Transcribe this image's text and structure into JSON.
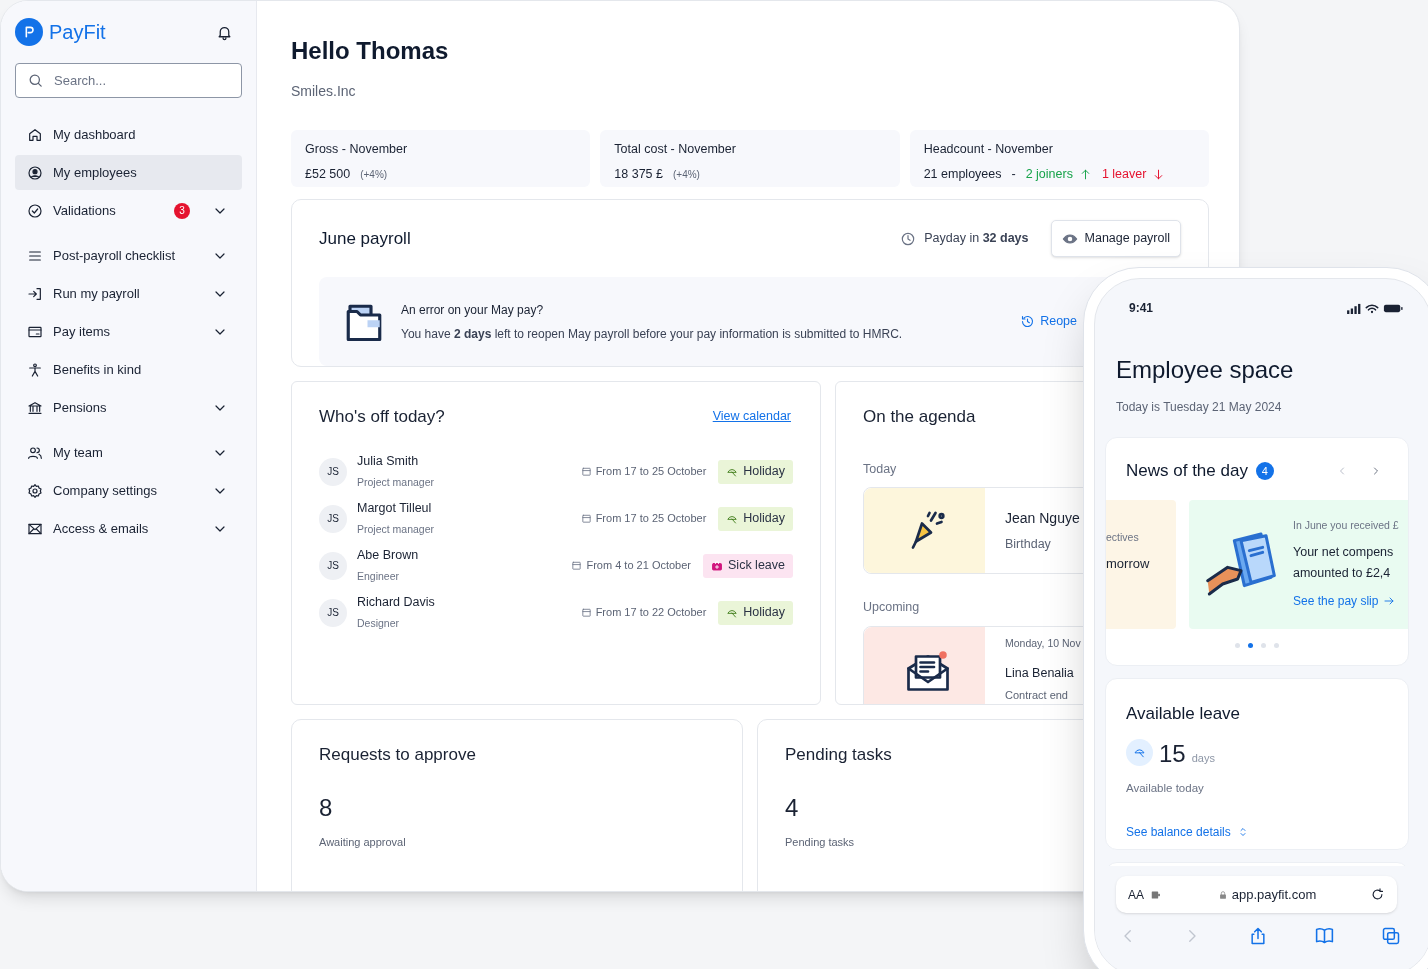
{
  "sidebar": {
    "logo": "PayFit",
    "search": {
      "placeholder": "Search..."
    },
    "items": [
      {
        "label": "My dashboard",
        "selected": false,
        "expandable": false
      },
      {
        "label": "My employees",
        "selected": true,
        "expandable": false
      },
      {
        "label": "Validations",
        "selected": false,
        "expandable": true,
        "badge": "3"
      },
      {
        "label": "Post-payroll checklist",
        "selected": false,
        "expandable": true
      },
      {
        "label": "Run my payroll",
        "selected": false,
        "expandable": true
      },
      {
        "label": "Pay items",
        "selected": false,
        "expandable": true
      },
      {
        "label": "Benefits in kind",
        "selected": false,
        "expandable": false
      },
      {
        "label": "Pensions",
        "selected": false,
        "expandable": true
      },
      {
        "label": "My team",
        "selected": false,
        "expandable": true
      },
      {
        "label": "Company settings",
        "selected": false,
        "expandable": true
      },
      {
        "label": "Access & emails",
        "selected": false,
        "expandable": true
      }
    ]
  },
  "header": {
    "title": "Hello Thomas",
    "company": "Smiles.Inc"
  },
  "stats": [
    {
      "label": "Gross - November",
      "value": "£52 500",
      "change": "(+4%)"
    },
    {
      "label": "Total cost - November",
      "value": "18 375 £",
      "change": "(+4%)"
    },
    {
      "label": "Headcount - November",
      "value": "21 employees",
      "separator": "-",
      "joiners": "2 joiners",
      "leavers": "1 leaver"
    }
  ],
  "payroll": {
    "title": "June payroll",
    "payday": "Payday in **32 days**",
    "button": "Manage payroll",
    "alert": {
      "title": "An error on your May pay?",
      "text": "You have **2 days** left to reopen May payroll before your pay information is submitted to HMRC.",
      "action": "Reope"
    }
  },
  "whos_off": {
    "title": "Who's off today?",
    "link": "View calendar",
    "rows": [
      {
        "initials": "JS",
        "name": "Julia Smith",
        "role": "Project manager",
        "dates": "From 17 to 25 October",
        "kind": "holiday",
        "tag": "Holiday"
      },
      {
        "initials": "JS",
        "name": "Margot Tilleul",
        "role": "Project manager",
        "dates": "From 17 to 25 October",
        "kind": "holiday",
        "tag": "Holiday"
      },
      {
        "initials": "JS",
        "name": "Abe Brown",
        "role": "Engineer",
        "dates": "From 4 to 21 October",
        "kind": "sick",
        "tag": "Sick leave"
      },
      {
        "initials": "JS",
        "name": "Richard Davis",
        "role": "Designer",
        "dates": "From 17 to 22 October",
        "kind": "holiday",
        "tag": "Holiday"
      }
    ]
  },
  "agenda": {
    "title": "On the agenda",
    "sections": [
      {
        "label": "Today",
        "event": {
          "kind": "birthday",
          "name": "Jean Nguye",
          "detail": "Birthday"
        }
      },
      {
        "label": "Upcoming",
        "event": {
          "kind": "contract",
          "date": "Monday, 10 Nov",
          "name": "Lina Benalia",
          "detail": "Contract end"
        }
      }
    ]
  },
  "requests": {
    "title": "Requests to approve",
    "count": "8",
    "caption": "Awaiting approval"
  },
  "tasks": {
    "title": "Pending tasks",
    "count": "4",
    "caption": "Pending tasks"
  },
  "phone": {
    "time": "9:41",
    "title": "Employee space",
    "date": "Today is Tuesday 21 May 2024",
    "news": {
      "title": "News of the day",
      "count": "4",
      "cards": [
        {
          "kind": "objectives",
          "caption": "ectives",
          "lines": [
            "morrow"
          ]
        },
        {
          "kind": "payslip",
          "caption": "In June you received £",
          "lines": [
            "Your net compens",
            "amounted to £2,4"
          ],
          "link": "See the pay slip"
        }
      ],
      "dots": [
        {
          "selected": false
        },
        {
          "selected": true
        },
        {
          "selected": false
        },
        {
          "selected": false
        }
      ]
    },
    "leave": {
      "title": "Available leave",
      "count": "15",
      "unit": "days",
      "caption": "Available today",
      "link": "See balance details"
    },
    "browser": {
      "text_size": "AA",
      "url": "app.payfit.com"
    }
  }
}
